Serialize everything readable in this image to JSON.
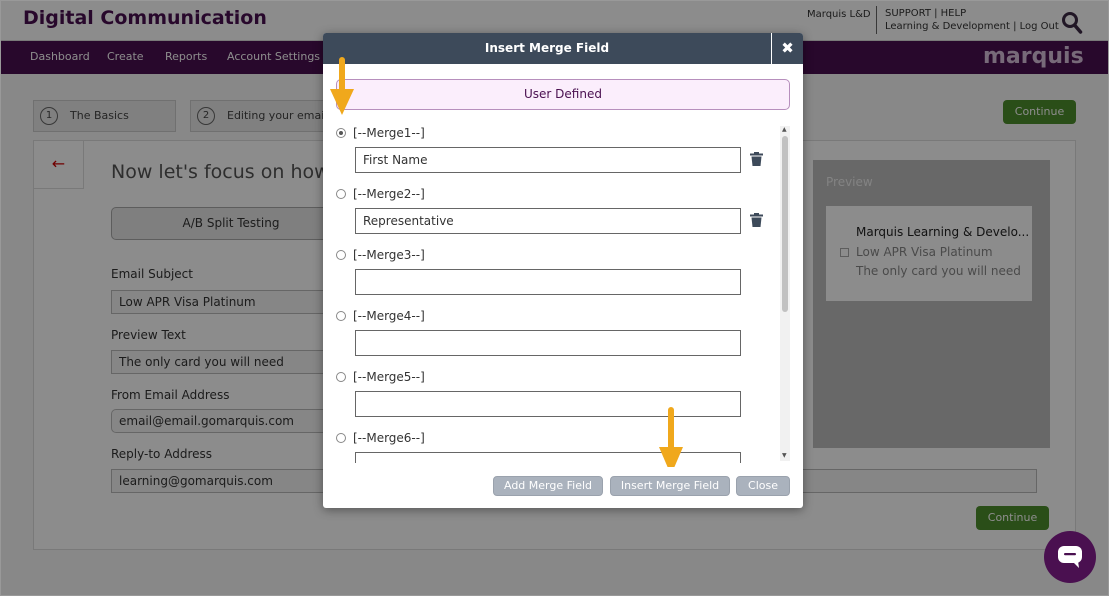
{
  "header": {
    "app_title": "Digital Communication",
    "user_name": "Marquis L&D",
    "links_line1": "SUPPORT | HELP",
    "links_line2": "Learning & Development | Log Out"
  },
  "nav": {
    "items": [
      "Dashboard",
      "Create",
      "Reports",
      "Account Settings"
    ],
    "brand": "marquis"
  },
  "steps": [
    {
      "num": "1",
      "label": "The Basics"
    },
    {
      "num": "2",
      "label": "Editing your email"
    }
  ],
  "buttons": {
    "continue_top": "Continue",
    "continue_bottom": "Continue"
  },
  "form": {
    "back_icon": "←",
    "heading": "Now let's focus on how y",
    "ab_button": "A/B Split Testing",
    "email_subject_label": "Email Subject",
    "email_subject_value": "Low APR Visa Platinum",
    "preview_text_label": "Preview Text",
    "preview_text_value": "The only card you will need",
    "from_label": "From Email Address",
    "from_value": "email@email.gomarquis.com",
    "reply_label": "Reply-to Address",
    "reply_value": "learning@gomarquis.com"
  },
  "preview": {
    "label": "Preview",
    "sender": "Marquis Learning & Develo...",
    "subject": "Low APR Visa Platinum",
    "preview_text": "The only card you will need"
  },
  "modal": {
    "title": "Insert Merge Field",
    "close_icon": "✖",
    "tab_label": "User Defined",
    "merge_fields": [
      {
        "tag": "[--Merge1--]",
        "value": "First Name",
        "selected": true,
        "deletable": true
      },
      {
        "tag": "[--Merge2--]",
        "value": "Representative",
        "selected": false,
        "deletable": true
      },
      {
        "tag": "[--Merge3--]",
        "value": "",
        "selected": false,
        "deletable": false
      },
      {
        "tag": "[--Merge4--]",
        "value": "",
        "selected": false,
        "deletable": false
      },
      {
        "tag": "[--Merge5--]",
        "value": "",
        "selected": false,
        "deletable": false
      },
      {
        "tag": "[--Merge6--]",
        "value": "",
        "selected": false,
        "deletable": false
      }
    ],
    "add_button": "Add Merge Field",
    "insert_button": "Insert Merge Field",
    "close_button": "Close"
  },
  "colors": {
    "brand_purple": "#4a1050",
    "modal_header": "#3d4a5a",
    "arrow": "#f0a81c",
    "continue_green": "#4e8f2c"
  },
  "icons": {
    "search": "search-icon",
    "trash": "trash-icon",
    "chat": "chat-icon"
  }
}
